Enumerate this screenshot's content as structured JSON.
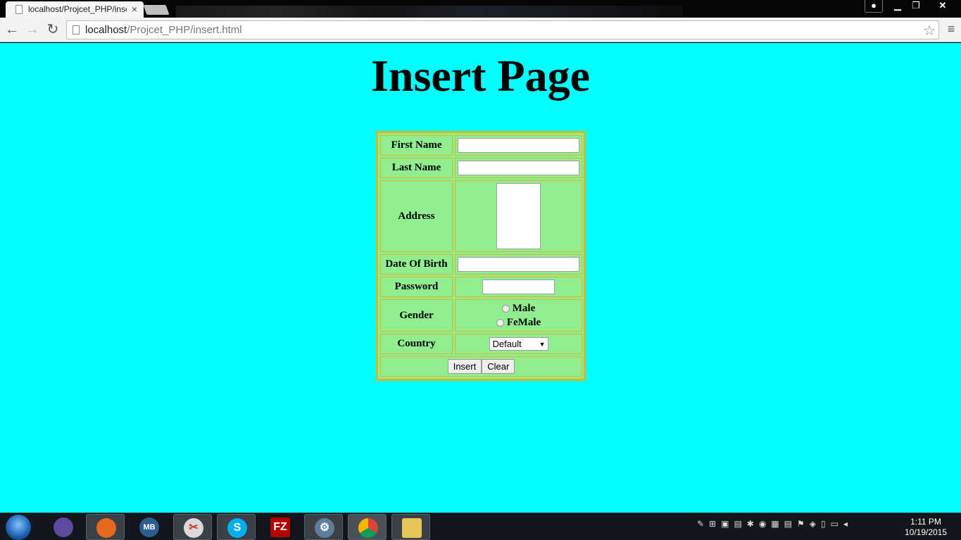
{
  "browser": {
    "tab_title": "localhost/Projcet_PHP/insert.html",
    "tab_close": "×",
    "url_host": "localhost",
    "url_path": "/Projcet_PHP/insert.html",
    "window_controls": {
      "min": "▁",
      "max": "❐",
      "close": "✕"
    },
    "nav": {
      "back": "←",
      "forward": "→",
      "reload": "↻",
      "star": "☆",
      "menu": "≡"
    }
  },
  "page": {
    "background_color": "#00ffff",
    "title": "Insert Page",
    "form": {
      "table_bg": "#90ee90",
      "border_color": "#d4b82a",
      "first_name_label": "First Name",
      "last_name_label": "Last Name",
      "address_label": "Address",
      "dob_label": "Date Of Birth",
      "password_label": "Password",
      "gender_label": "Gender",
      "gender_options": [
        "Male",
        "FeMale"
      ],
      "country_label": "Country",
      "country_selected": "Default",
      "insert_button": "Insert",
      "clear_button": "Clear"
    }
  },
  "taskbar": {
    "apps": [
      "eclipse-icon",
      "firefox-icon",
      "mb-icon",
      "paint-icon",
      "skype-icon",
      "filezilla-icon",
      "tool-icon",
      "chrome-icon",
      "explorer-icon"
    ],
    "clock_time": "1:11 PM",
    "clock_date": "10/19/2015"
  }
}
